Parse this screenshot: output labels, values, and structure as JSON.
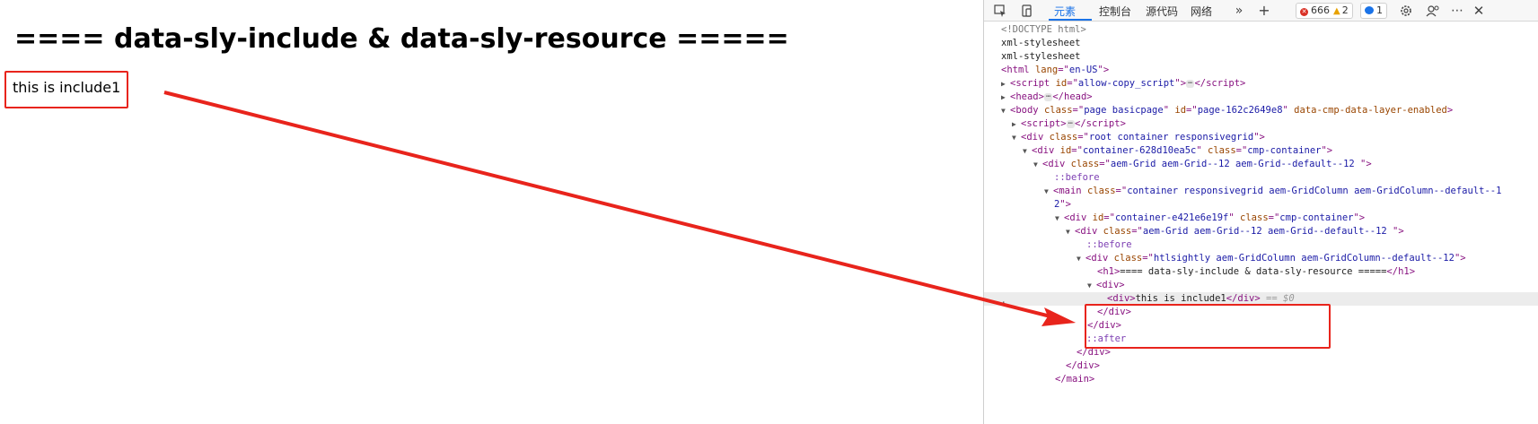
{
  "page": {
    "heading": "==== data-sly-include & data-sly-resource =====",
    "include_text": "this is include1"
  },
  "devtools": {
    "tabs": [
      "元素",
      "控制台",
      "源代码",
      "网络"
    ],
    "active_tab": "元素",
    "errors_count": "666",
    "warnings_count": "2",
    "messages_count": "1",
    "icons": [
      "inspect-icon",
      "device-toggle-icon",
      "more-tabs-icon",
      "add-tab-icon",
      "settings-icon",
      "customize-icon",
      "more-options-icon",
      "close-icon"
    ],
    "selected_marker": "...",
    "selected_suffix": "== $0"
  },
  "dom": {
    "doctype": "<!DOCTYPE html>",
    "xml1": "xml-stylesheet",
    "xml2": "xml-stylesheet",
    "html_lang": "en-US",
    "script_id": "allow-copy_script",
    "body_class": "page basicpage",
    "body_id": "page-162c2649e8",
    "body_attr": "data-cmp-data-layer-enabled",
    "root_class": "root container responsivegrid",
    "container1_id": "container-628d10ea5c",
    "container_class": "cmp-container",
    "grid_class": "aem-Grid aem-Grid--12 aem-Grid--default--12 ",
    "before": "::before",
    "after": "::after",
    "main_class_line1": "container responsivegrid aem-GridColumn aem-GridColumn--default--1",
    "main_class_line2": "2",
    "container2_id": "container-e421e6e19f",
    "htl_class": "htlsightly aem-GridColumn aem-GridColumn--default--12",
    "h1_text": "==== data-sly-include & data-sly-resource =====",
    "include_text": "this is include1"
  },
  "colors": {
    "annotation": "#e8241c",
    "tag": "#881280",
    "attr_name": "#994500",
    "attr_value": "#1a1aa6",
    "active_tab": "#1a73e8"
  }
}
